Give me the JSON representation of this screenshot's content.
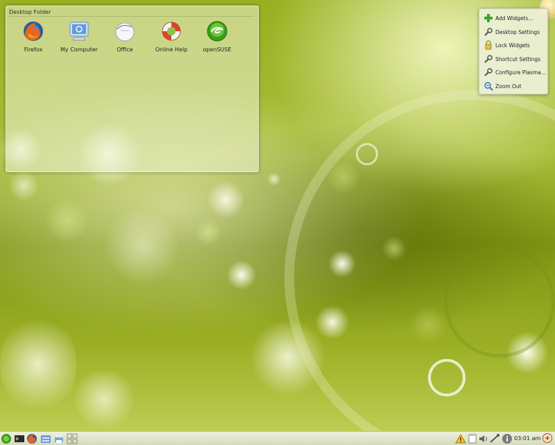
{
  "folder": {
    "title": "Desktop Folder",
    "icons": [
      {
        "label": "Firefox",
        "icon": "firefox-icon"
      },
      {
        "label": "My Computer",
        "icon": "computer-icon"
      },
      {
        "label": "Office",
        "icon": "office-icon"
      },
      {
        "label": "Online Help",
        "icon": "help-lifebuoy-icon"
      },
      {
        "label": "openSUSE",
        "icon": "opensuse-icon"
      }
    ]
  },
  "context_menu": {
    "items": [
      {
        "label": "Add Widgets...",
        "icon": "plus-icon"
      },
      {
        "label": "Desktop Settings",
        "icon": "wrench-icon"
      },
      {
        "label": "Lock Widgets",
        "icon": "lock-icon"
      },
      {
        "label": "Shortcut Settings",
        "icon": "wrench-icon"
      },
      {
        "label": "Configure Plasma...",
        "icon": "wrench-icon"
      },
      {
        "label": "Zoom Out",
        "icon": "zoom-out-icon"
      }
    ]
  },
  "panel": {
    "clock": "03:01 am"
  },
  "colors": {
    "wallpaper_green": "#9ab021",
    "panel_bg": "#e2e6cd",
    "opensuse_green": "#3a9c19"
  }
}
